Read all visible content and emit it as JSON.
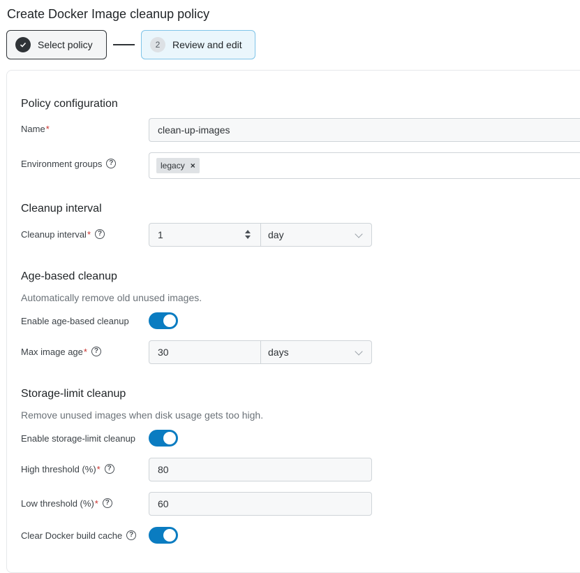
{
  "page": {
    "title": "Create Docker Image cleanup policy"
  },
  "stepper": {
    "steps": [
      {
        "number": "1",
        "label": "Select policy",
        "state": "complete"
      },
      {
        "number": "2",
        "label": "Review and edit",
        "state": "active"
      }
    ]
  },
  "policy_configuration": {
    "title": "Policy configuration",
    "name": {
      "label": "Name",
      "value": "clean-up-images"
    },
    "environment_groups": {
      "label": "Environment groups",
      "tags": [
        "legacy"
      ]
    }
  },
  "cleanup_interval": {
    "title": "Cleanup interval",
    "field": {
      "label": "Cleanup interval",
      "value": "1",
      "unit": "day"
    }
  },
  "age_based": {
    "title": "Age-based cleanup",
    "description": "Automatically remove old unused images.",
    "enable": {
      "label": "Enable age-based cleanup",
      "on": true
    },
    "max_age": {
      "label": "Max image age",
      "value": "30",
      "unit": "days"
    }
  },
  "storage_limit": {
    "title": "Storage-limit cleanup",
    "description": "Remove unused images when disk usage gets too high.",
    "enable": {
      "label": "Enable storage-limit cleanup",
      "on": true
    },
    "high_threshold": {
      "label": "High threshold (%)",
      "value": "80"
    },
    "low_threshold": {
      "label": "Low threshold (%)",
      "value": "60"
    },
    "clear_cache": {
      "label": "Clear Docker build cache",
      "on": true
    }
  },
  "colors": {
    "accent": "#0a7cc1",
    "required": "#c9302c",
    "active_step_bg": "#eaf6fc",
    "active_step_border": "#7fc4e8"
  }
}
